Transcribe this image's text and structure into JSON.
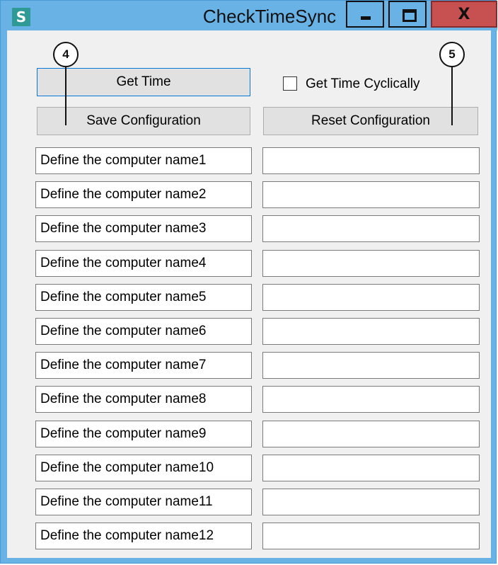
{
  "window": {
    "app_icon_letter": "S",
    "title": "CheckTimeSync",
    "close_label": "X"
  },
  "toolbar": {
    "get_time_label": "Get Time",
    "get_time_cyclically_label": "Get Time Cyclically",
    "save_configuration_label": "Save Configuration",
    "reset_configuration_label": "Reset Configuration"
  },
  "computers": [
    {
      "name": "Define the computer name1",
      "value": ""
    },
    {
      "name": "Define the computer name2",
      "value": ""
    },
    {
      "name": "Define the computer name3",
      "value": ""
    },
    {
      "name": "Define the computer name4",
      "value": ""
    },
    {
      "name": "Define the computer name5",
      "value": ""
    },
    {
      "name": "Define the computer name6",
      "value": ""
    },
    {
      "name": "Define the computer name7",
      "value": ""
    },
    {
      "name": "Define the computer name8",
      "value": ""
    },
    {
      "name": "Define the computer name9",
      "value": ""
    },
    {
      "name": "Define the computer name10",
      "value": ""
    },
    {
      "name": "Define the computer name11",
      "value": ""
    },
    {
      "name": "Define the computer name12",
      "value": ""
    }
  ],
  "callouts": [
    "4",
    "5"
  ],
  "colors": {
    "titlebar": "#69b2e6",
    "close_button": "#c75050",
    "app_icon": "#2f9a95",
    "client_background": "#f0f0f0"
  }
}
